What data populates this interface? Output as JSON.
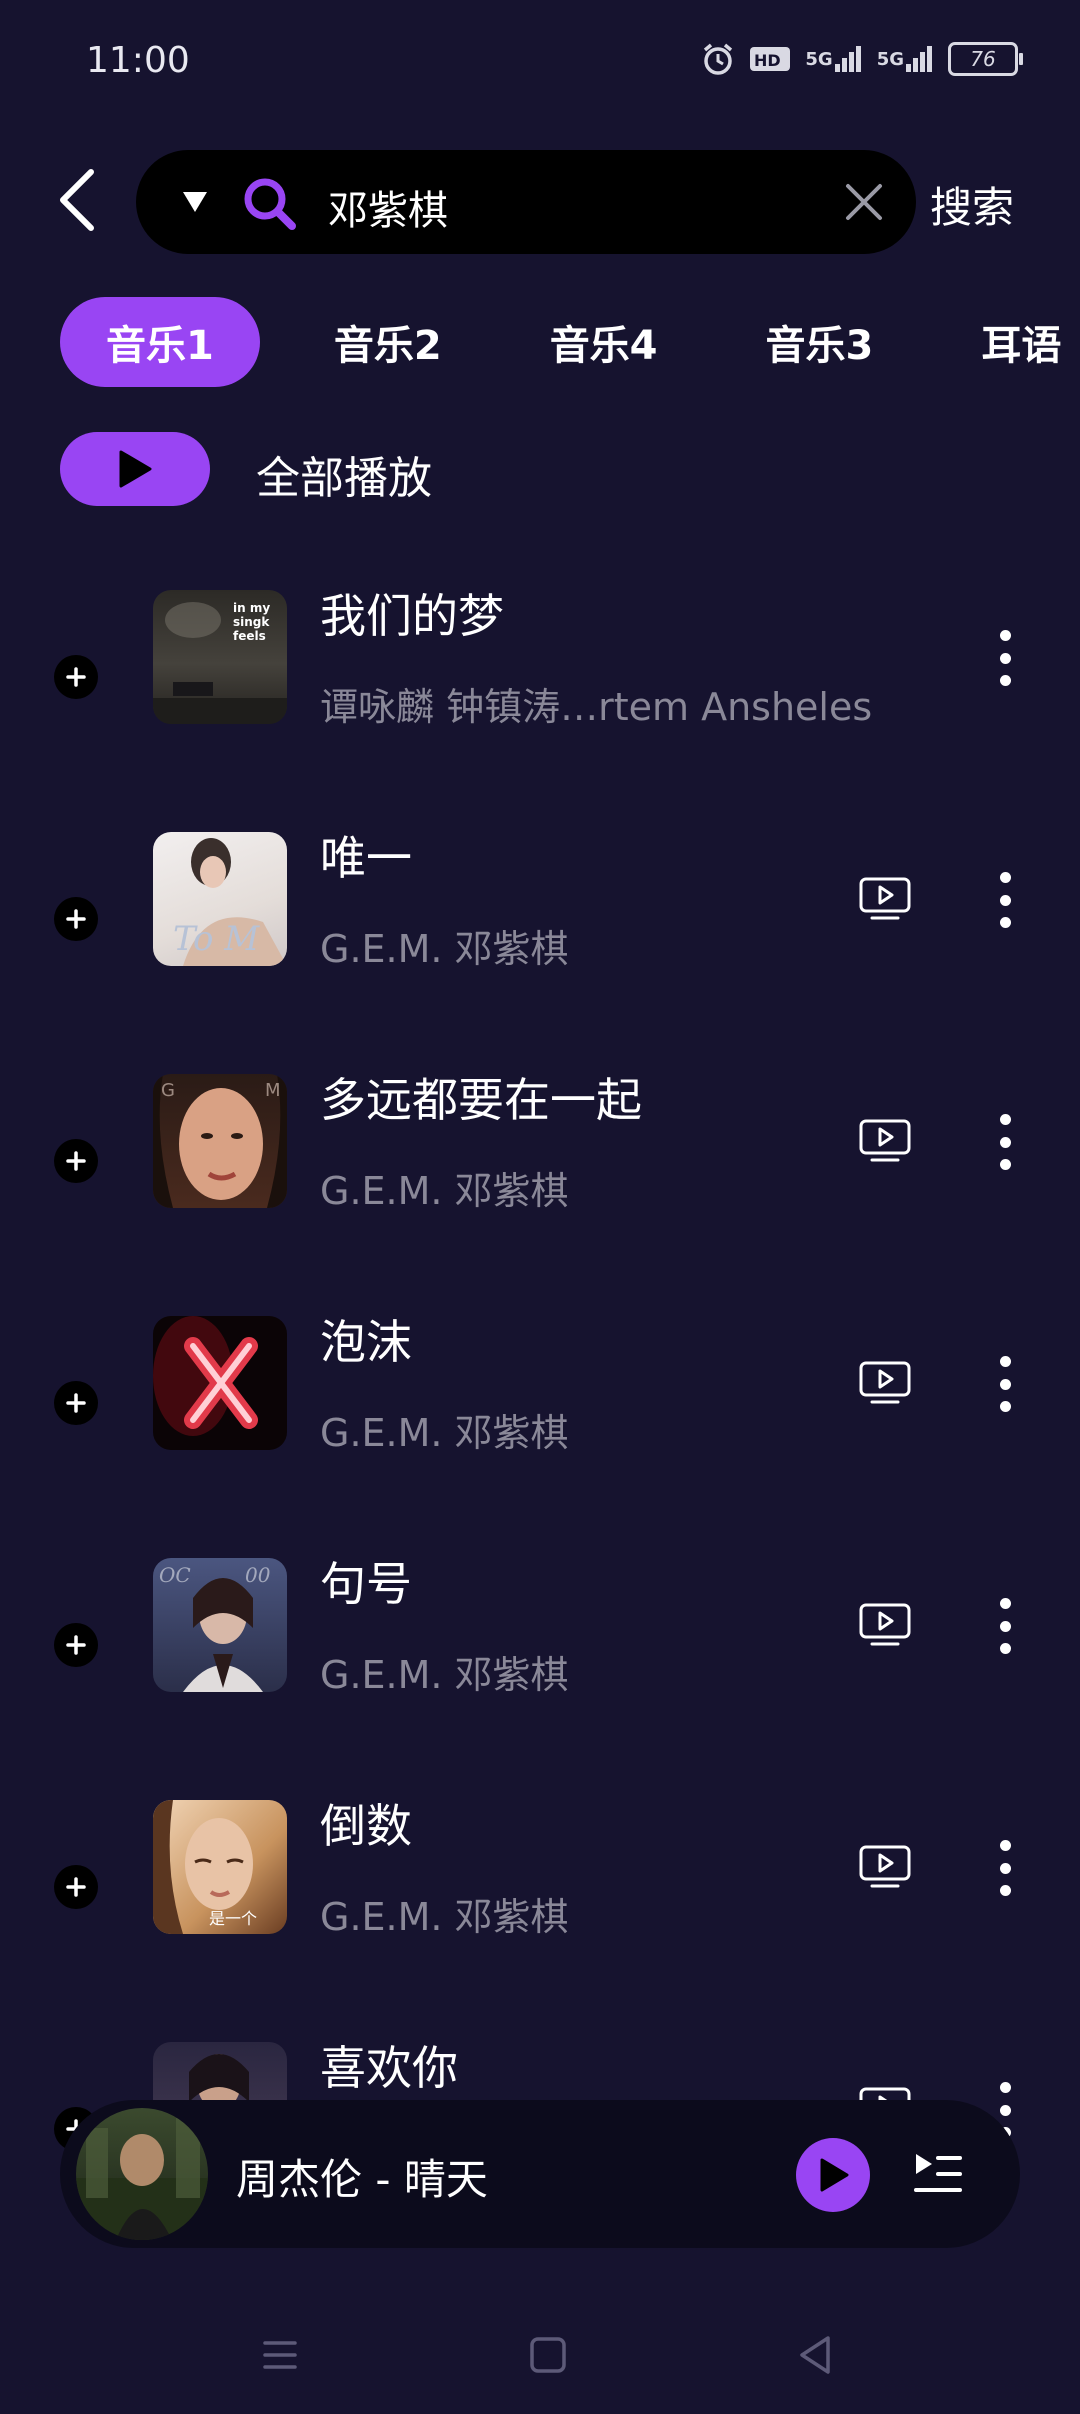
{
  "status_bar": {
    "time": "11:00",
    "signal_1": "5G",
    "signal_2": "5G",
    "battery": "76"
  },
  "search": {
    "query": "邓紫棋",
    "button_label": "搜索"
  },
  "tabs": [
    {
      "label": "音乐1",
      "active": true
    },
    {
      "label": "音乐2",
      "active": false
    },
    {
      "label": "音乐4",
      "active": false
    },
    {
      "label": "音乐3",
      "active": false
    },
    {
      "label": "耳语",
      "active": false
    }
  ],
  "play_all": {
    "label": "全部播放"
  },
  "songs": [
    {
      "title": "我们的梦",
      "artist": "谭咏麟 钟镇涛…rtem Ansheles",
      "has_mv": false,
      "cover_text": "in my\nsingk\nfeels"
    },
    {
      "title": "唯一",
      "artist": "G.E.M. 邓紫棋",
      "has_mv": true
    },
    {
      "title": "多远都要在一起",
      "artist": "G.E.M. 邓紫棋",
      "has_mv": true
    },
    {
      "title": "泡沫",
      "artist": "G.E.M. 邓紫棋",
      "has_mv": true
    },
    {
      "title": "句号",
      "artist": "G.E.M. 邓紫棋",
      "has_mv": true
    },
    {
      "title": "倒数",
      "artist": "G.E.M. 邓紫棋",
      "has_mv": true
    },
    {
      "title": "喜欢你",
      "artist": "",
      "has_mv": true
    }
  ],
  "mini_player": {
    "title": "周杰伦 - 晴天"
  },
  "colors": {
    "background": "#16132f",
    "accent": "#9945f3",
    "muted_text": "#8a8898"
  }
}
